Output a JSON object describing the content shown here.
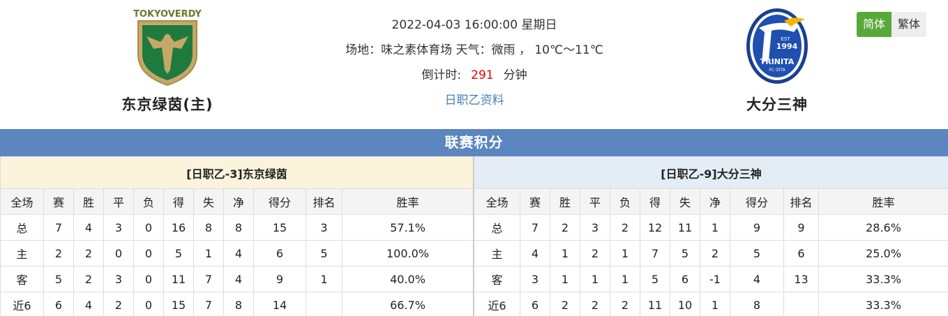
{
  "match": {
    "datetime": "2022-04-03 16:00:00 星期日",
    "venue_line": "场地：味之素体育场 天气：微雨 ， 10℃～11℃",
    "countdown_label": "倒计时:",
    "countdown_value": "291",
    "countdown_unit": "分钟",
    "league_link": "日职乙资料"
  },
  "home_team": {
    "name": "东京绿茵(主)",
    "logo_icon": "tokyo-verdy-logo-icon",
    "logo_text": "TOKYOVERDY"
  },
  "away_team": {
    "name": "大分三神",
    "logo_icon": "oita-trinita-logo-icon",
    "logo_text_top": "EST",
    "logo_text_year": "1994",
    "logo_text_name": "TRINITA",
    "logo_text_sub": "FC OITA"
  },
  "lang": {
    "simplified": "简体",
    "traditional": "繁体"
  },
  "colors": {
    "accent_green": "#58a83a",
    "title_blue": "#5b86c0",
    "countdown_red": "#e60000",
    "link_blue": "#4a7eb8"
  },
  "section_title": "联赛积分",
  "columns": [
    "全场",
    "赛",
    "胜",
    "平",
    "负",
    "得",
    "失",
    "净",
    "得分",
    "排名",
    "胜率"
  ],
  "standings_left": {
    "title": "[日职乙-3]东京绿茵",
    "rows": [
      [
        "总",
        "7",
        "4",
        "3",
        "0",
        "16",
        "8",
        "8",
        "15",
        "3",
        "57.1%"
      ],
      [
        "主",
        "2",
        "2",
        "0",
        "0",
        "5",
        "1",
        "4",
        "6",
        "5",
        "100.0%"
      ],
      [
        "客",
        "5",
        "2",
        "3",
        "0",
        "11",
        "7",
        "4",
        "9",
        "1",
        "40.0%"
      ],
      [
        "近6",
        "6",
        "4",
        "2",
        "0",
        "15",
        "7",
        "8",
        "14",
        "",
        "66.7%"
      ]
    ]
  },
  "standings_right": {
    "title": "[日职乙-9]大分三神",
    "rows": [
      [
        "总",
        "7",
        "2",
        "3",
        "2",
        "12",
        "11",
        "1",
        "9",
        "9",
        "28.6%"
      ],
      [
        "主",
        "4",
        "1",
        "2",
        "1",
        "7",
        "5",
        "2",
        "5",
        "6",
        "25.0%"
      ],
      [
        "客",
        "3",
        "1",
        "1",
        "1",
        "5",
        "6",
        "-1",
        "4",
        "13",
        "33.3%"
      ],
      [
        "近6",
        "6",
        "2",
        "2",
        "2",
        "11",
        "10",
        "1",
        "8",
        "",
        "33.3%"
      ]
    ]
  }
}
